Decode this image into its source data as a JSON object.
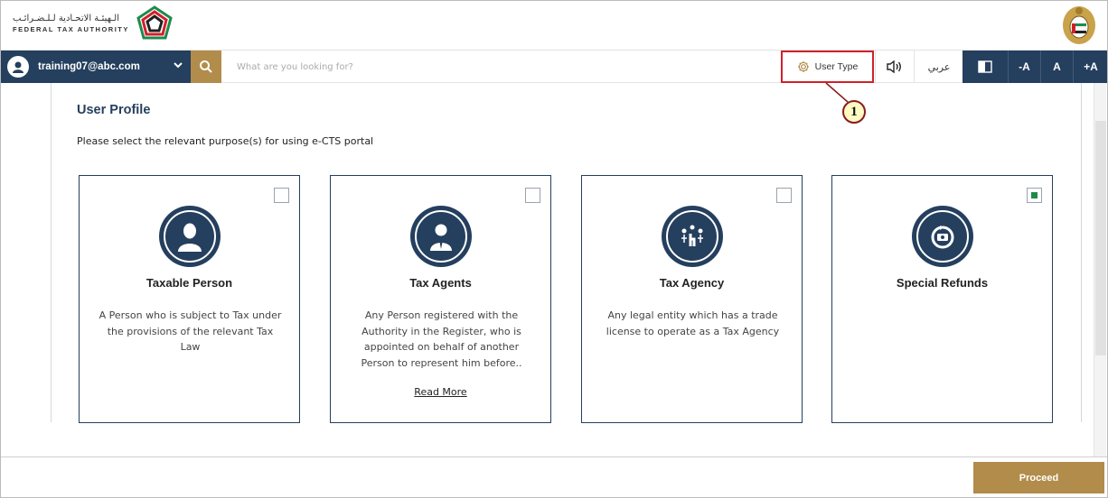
{
  "header": {
    "logo_arabic": "الـهيئـة الاتحـادية لـلـضـرائـب",
    "logo_english": "FEDERAL TAX AUTHORITY"
  },
  "navbar": {
    "user_email": "training07@abc.com",
    "search_placeholder": "What are you looking for?",
    "user_type_label": "User Type",
    "arabic_label": "عربي",
    "font_decrease": "-A",
    "font_normal": "A",
    "font_increase": "+A"
  },
  "callout": {
    "number": "1",
    "color": "#d0212a"
  },
  "page": {
    "title": "User Profile",
    "subtitle": "Please select the relevant purpose(s) for using e-CTS portal"
  },
  "cards": [
    {
      "title": "Taxable Person",
      "description": "A Person who is subject to Tax under the provisions of the relevant Tax Law",
      "read_more": "",
      "checked": false,
      "icon": "person-icon"
    },
    {
      "title": "Tax Agents",
      "description": "Any Person registered with the Authority in the Register, who is appointed on behalf of another Person to represent him before..",
      "read_more": "Read More",
      "checked": false,
      "icon": "agent-icon"
    },
    {
      "title": "Tax Agency",
      "description": "Any legal entity which has a trade license to operate as a Tax Agency",
      "read_more": "",
      "checked": false,
      "icon": "agency-network-icon"
    },
    {
      "title": "Special Refunds",
      "description": "",
      "read_more": "",
      "checked": true,
      "icon": "refund-icon"
    }
  ],
  "footer": {
    "proceed_label": "Proceed"
  },
  "colors": {
    "navy": "#253f5e",
    "gold": "#b28c4b",
    "check_green": "#1e8a4c"
  }
}
